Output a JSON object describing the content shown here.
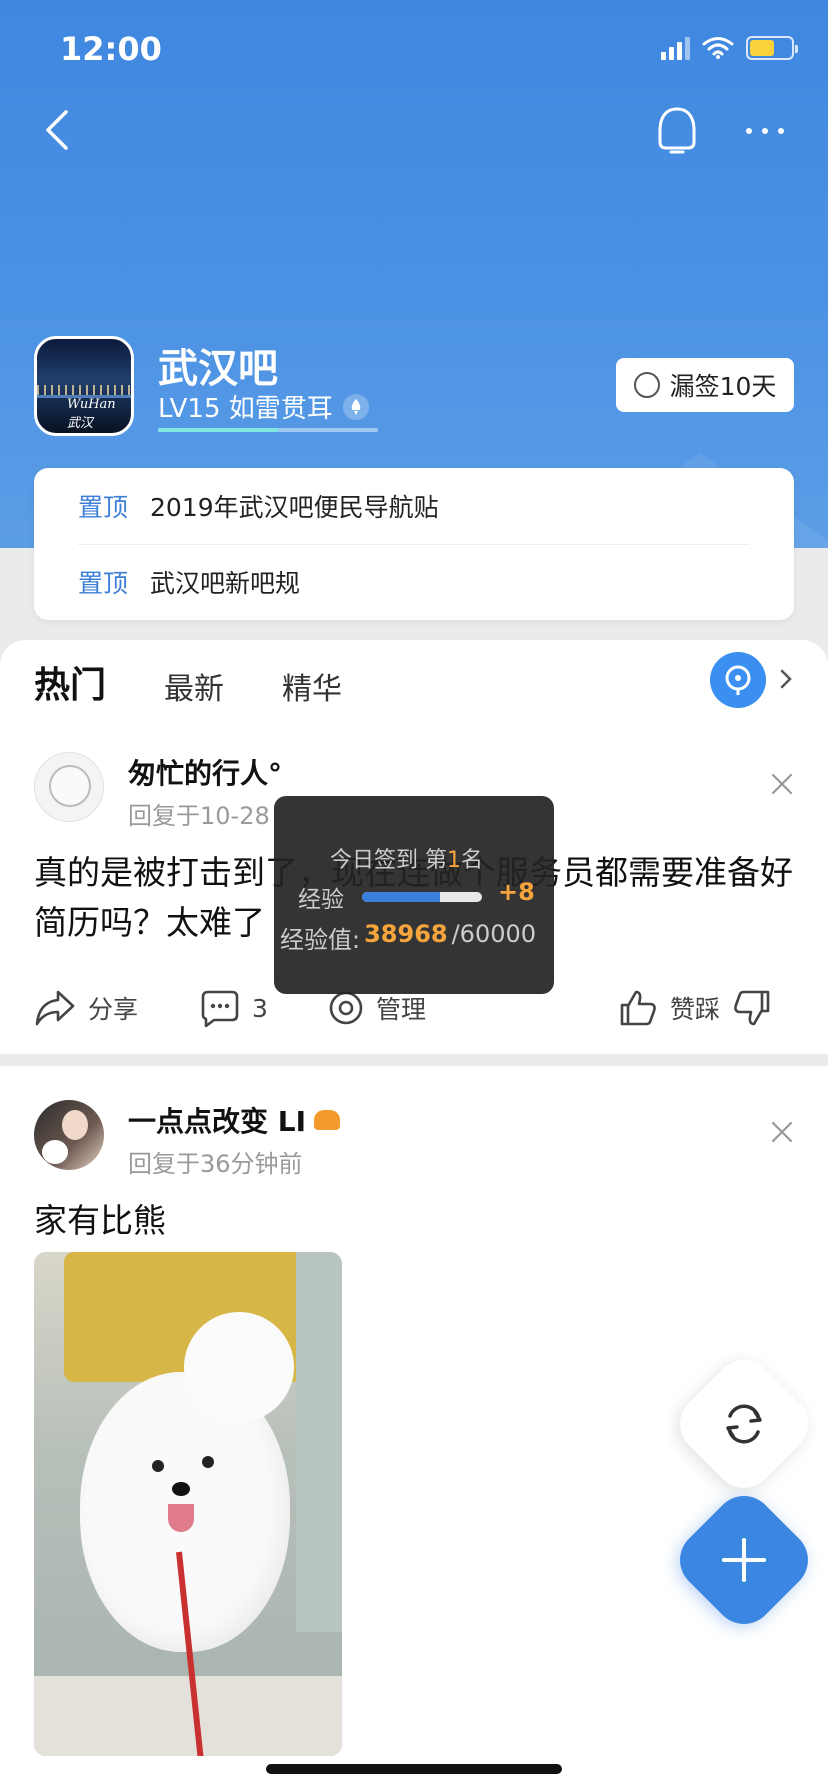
{
  "status_bar": {
    "time": "12:00"
  },
  "forum": {
    "name": "武汉吧",
    "level": "LV15 如雷贯耳",
    "signin_label": "漏签10天"
  },
  "pinned": [
    {
      "tag": "置顶",
      "title": "2019年武汉吧便民导航贴"
    },
    {
      "tag": "置顶",
      "title": "武汉吧新吧规"
    }
  ],
  "tabs": [
    {
      "label": "热门",
      "active": true
    },
    {
      "label": "最新",
      "active": false
    },
    {
      "label": "精华",
      "active": false
    }
  ],
  "posts": [
    {
      "username": "匆忙的行人°",
      "meta": "回复于10-28",
      "text": "真的是被打击到了，现在连做个服务员都需要准备好简历吗？太难了",
      "actions": {
        "share": "分享",
        "comments": "3",
        "manage": "管理",
        "vote": "赞踩"
      }
    },
    {
      "username": "一点点改变 LI",
      "meta": "回复于36分钟前",
      "text": "家有比熊"
    }
  ],
  "toast": {
    "rank_prefix": "今日签到 第",
    "rank_num": "1",
    "rank_suffix": "名",
    "exp_label": "经验",
    "exp_gain": "+8",
    "total_label": "经验值:",
    "current": "38968",
    "max": "/60000",
    "progress_fraction": 0.649
  },
  "colors": {
    "header_blue": "#4a90e2",
    "accent_blue": "#3b86e0",
    "pin_tag": "#3c7ed8",
    "exp_orange": "#f5a53b"
  }
}
